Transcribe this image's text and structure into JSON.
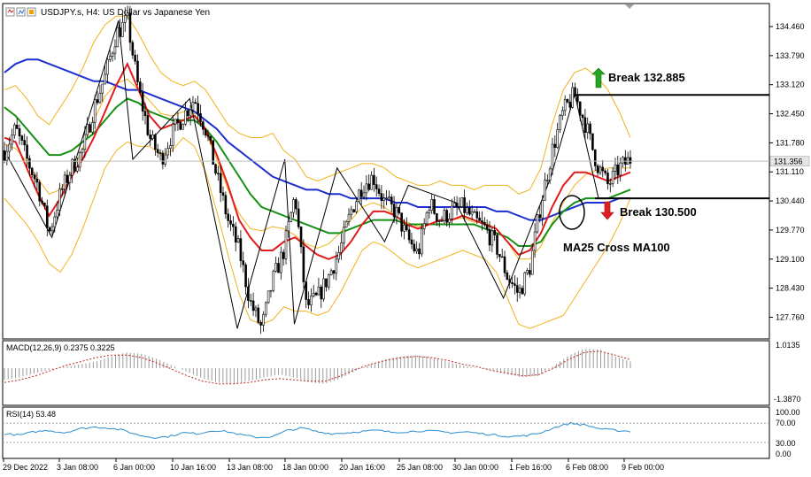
{
  "header": {
    "title": "USDJPY.s, H4:  US Dollar vs Japanese Yen",
    "icons": [
      "sell-icon",
      "buy-icon"
    ]
  },
  "chart_data": {
    "type": "line",
    "symbol": "USDJPY.s",
    "timeframe": "H4",
    "instrument": "US Dollar vs Japanese Yen",
    "current_price": "131.356",
    "main": {
      "ylim": [
        127.3,
        134.95
      ],
      "y_ticks": [
        "134.460",
        "133.790",
        "133.120",
        "132.450",
        "131.780",
        "131.110",
        "130.440",
        "129.770",
        "129.100",
        "128.430",
        "127.760"
      ],
      "x_ticks": [
        "29 Dec 2022",
        "3 Jan 08:00",
        "6 Jan 00:00",
        "10 Jan 16:00",
        "13 Jan 08:00",
        "18 Jan 00:00",
        "20 Jan 16:00",
        "25 Jan 08:00",
        "30 Jan 00:00",
        "1 Feb 16:00",
        "6 Feb 08:00",
        "9 Feb 00:00"
      ],
      "price_path": [
        131.6,
        132.1,
        131.4,
        130.8,
        129.7,
        130.6,
        131.2,
        131.6,
        132.6,
        133.3,
        134.3,
        134.6,
        133.0,
        131.9,
        131.4,
        132.0,
        132.4,
        132.8,
        132.1,
        131.0,
        130.0,
        129.3,
        128.1,
        127.5,
        128.6,
        129.3,
        130.6,
        128.0,
        128.2,
        128.7,
        129.3,
        130.2,
        130.8,
        131.0,
        130.4,
        130.2,
        129.6,
        129.2,
        130.4,
        130.0,
        130.2,
        130.3,
        130.0,
        129.8,
        129.4,
        128.7,
        128.3,
        128.9,
        130.4,
        131.6,
        132.5,
        132.9,
        132.2,
        131.3,
        130.8,
        131.2,
        131.4
      ],
      "ma_red": [
        131.9,
        131.8,
        131.2,
        130.6,
        130.1,
        130.5,
        131.0,
        131.4,
        131.9,
        132.5,
        133.1,
        133.6,
        133.0,
        132.4,
        132.1,
        132.2,
        132.3,
        132.4,
        132.1,
        131.5,
        130.8,
        130.0,
        129.6,
        129.3,
        129.3,
        129.5,
        129.6,
        129.4,
        129.2,
        129.1,
        129.2,
        129.5,
        129.9,
        130.2,
        130.2,
        130.1,
        129.9,
        129.8,
        129.9,
        130.0,
        130.0,
        130.1,
        130.0,
        129.9,
        129.8,
        129.5,
        129.2,
        129.3,
        129.7,
        130.3,
        130.8,
        131.1,
        131.1,
        131.0,
        130.9,
        131.0,
        131.1
      ],
      "ma_green": [
        132.6,
        132.4,
        132.1,
        131.8,
        131.5,
        131.5,
        131.6,
        131.8,
        132.0,
        132.3,
        132.6,
        132.8,
        132.7,
        132.5,
        132.4,
        132.3,
        132.3,
        132.3,
        132.1,
        131.8,
        131.4,
        131.0,
        130.6,
        130.3,
        130.2,
        130.1,
        130.0,
        129.9,
        129.8,
        129.7,
        129.7,
        129.8,
        129.9,
        130.0,
        130.0,
        130.0,
        129.9,
        129.9,
        129.9,
        129.9,
        129.9,
        129.9,
        129.9,
        129.8,
        129.7,
        129.6,
        129.4,
        129.4,
        129.5,
        129.9,
        130.2,
        130.4,
        130.5,
        130.5,
        130.5,
        130.6,
        130.7
      ],
      "ma_blue": [
        133.4,
        133.6,
        133.7,
        133.7,
        133.6,
        133.5,
        133.4,
        133.3,
        133.2,
        133.2,
        133.1,
        133.0,
        133.0,
        132.9,
        132.8,
        132.7,
        132.6,
        132.5,
        132.3,
        132.1,
        131.8,
        131.6,
        131.4,
        131.2,
        131.0,
        130.9,
        130.8,
        130.7,
        130.7,
        130.6,
        130.6,
        130.5,
        130.5,
        130.5,
        130.5,
        130.4,
        130.4,
        130.3,
        130.3,
        130.3,
        130.3,
        130.3,
        130.3,
        130.3,
        130.2,
        130.2,
        130.1,
        130.0,
        130.0,
        130.1,
        130.2,
        130.3,
        130.4,
        130.4,
        130.4,
        130.5,
        130.5
      ],
      "bb_upper": [
        133.0,
        133.1,
        132.8,
        132.4,
        132.2,
        132.6,
        133.0,
        133.5,
        134.1,
        134.5,
        134.7,
        134.7,
        134.3,
        133.8,
        133.4,
        133.2,
        133.1,
        133.2,
        133.0,
        132.6,
        132.2,
        132.0,
        131.9,
        131.9,
        132.0,
        131.6,
        131.4,
        131.0,
        130.9,
        131.0,
        131.1,
        131.2,
        131.3,
        131.3,
        131.2,
        131.0,
        130.9,
        130.8,
        130.8,
        130.9,
        130.8,
        130.8,
        130.7,
        130.8,
        130.8,
        130.8,
        130.6,
        130.7,
        131.2,
        132.2,
        133.0,
        133.4,
        133.5,
        133.3,
        133.0,
        132.5,
        131.9
      ],
      "bb_lower": [
        130.5,
        130.2,
        129.9,
        129.5,
        129.0,
        128.8,
        129.2,
        129.8,
        130.5,
        131.2,
        131.6,
        131.8,
        131.7,
        131.7,
        131.5,
        131.6,
        131.9,
        131.7,
        131.1,
        130.2,
        129.2,
        128.3,
        127.7,
        127.6,
        127.7,
        128.0,
        127.9,
        127.9,
        127.8,
        127.9,
        128.3,
        128.8,
        129.3,
        129.5,
        129.4,
        129.2,
        129.0,
        128.9,
        129.0,
        129.1,
        129.2,
        129.3,
        129.2,
        129.1,
        128.8,
        128.2,
        127.6,
        127.5,
        127.6,
        127.7,
        127.8,
        128.2,
        128.6,
        129.0,
        129.4,
        129.9,
        130.5
      ],
      "zigzag": [
        [
          0,
          131.6
        ],
        [
          10,
          129.6
        ],
        [
          24,
          134.6
        ],
        [
          27,
          131.4
        ],
        [
          39,
          132.8
        ],
        [
          49,
          127.5
        ],
        [
          59,
          131.4
        ],
        [
          61,
          127.6
        ],
        [
          70,
          131.2
        ],
        [
          80,
          129.5
        ],
        [
          85,
          130.8
        ],
        [
          95,
          130.4
        ],
        [
          105,
          128.2
        ],
        [
          115,
          131.0
        ],
        [
          120,
          132.9
        ],
        [
          125,
          130.5
        ]
      ],
      "resistance": {
        "price": 132.885,
        "label": "Break 132.885"
      },
      "support": {
        "price": 130.5,
        "label": "Break 130.500"
      },
      "cross_label": "MA25 Cross MA100",
      "current_line": 131.356
    },
    "macd": {
      "title": "MACD(12,26,9) 0.2375 0.3225",
      "y_ticks": [
        "1.0135",
        "-1.3870"
      ],
      "ylim": [
        -1.387,
        1.0135
      ],
      "hist": [
        -0.45,
        -0.35,
        -0.2,
        -0.05,
        0.05,
        0.15,
        0.25,
        0.45,
        0.6,
        0.55,
        0.35,
        0.1,
        -0.15,
        -0.4,
        -0.55,
        -0.6,
        -0.5,
        -0.35,
        -0.25,
        -0.35,
        -0.55,
        -0.6,
        -0.4,
        -0.1,
        0.15,
        0.35,
        0.45,
        0.5,
        0.4,
        0.25,
        0.1,
        0.0,
        -0.1,
        -0.25,
        -0.35,
        -0.3,
        0.1,
        0.5,
        0.75,
        0.7,
        0.45,
        0.25
      ],
      "signal": [
        -0.55,
        -0.45,
        -0.3,
        -0.1,
        0.1,
        0.25,
        0.4,
        0.5,
        0.5,
        0.4,
        0.2,
        -0.05,
        -0.3,
        -0.5,
        -0.6,
        -0.6,
        -0.55,
        -0.45,
        -0.4,
        -0.45,
        -0.5,
        -0.5,
        -0.3,
        -0.05,
        0.15,
        0.3,
        0.4,
        0.45,
        0.4,
        0.3,
        0.15,
        0.05,
        -0.1,
        -0.2,
        -0.3,
        -0.25,
        0.0,
        0.35,
        0.6,
        0.65,
        0.5,
        0.32
      ]
    },
    "rsi": {
      "title": "RSI(14) 53.48",
      "y_ticks": [
        "100.00",
        "70.00",
        "30.00",
        "0.00"
      ],
      "levels": [
        70,
        30
      ],
      "values": [
        48,
        45,
        52,
        55,
        50,
        58,
        62,
        60,
        55,
        45,
        40,
        42,
        50,
        48,
        55,
        52,
        45,
        40,
        42,
        55,
        60,
        52,
        48,
        50,
        53,
        55,
        51,
        52,
        54,
        53,
        50,
        52,
        48,
        45,
        42,
        44,
        50,
        62,
        70,
        66,
        58,
        55,
        53
      ]
    }
  }
}
